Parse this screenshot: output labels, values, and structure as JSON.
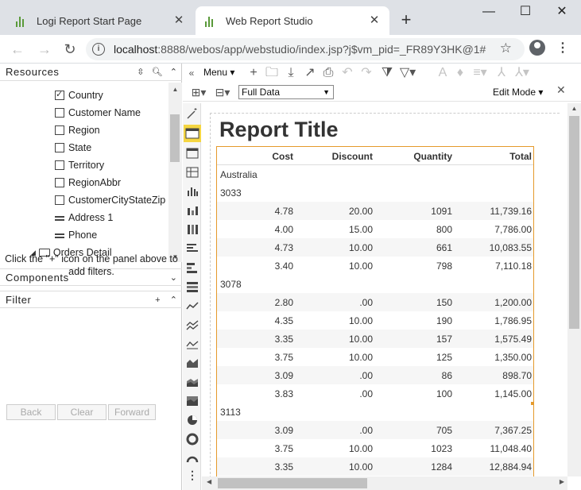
{
  "browser": {
    "tabs": [
      {
        "title": "Logi Report Start Page",
        "active": false
      },
      {
        "title": "Web Report Studio",
        "active": true
      }
    ],
    "url_host": "localhost",
    "url_path": ":8888/webos/app/webstudio/index.jsp?j$vm_pid=_FR89Y3HK@1#",
    "window_controls": {
      "minimize": "—",
      "maximize": "☐",
      "close": "✕"
    }
  },
  "left_panel": {
    "resources_title": "Resources",
    "tree": [
      {
        "label": "Country",
        "kind": "checkbox",
        "checked": true
      },
      {
        "label": "Customer Name",
        "kind": "checkbox",
        "checked": false
      },
      {
        "label": "Region",
        "kind": "checkbox",
        "checked": false
      },
      {
        "label": "State",
        "kind": "checkbox",
        "checked": false
      },
      {
        "label": "Territory",
        "kind": "checkbox",
        "checked": false
      },
      {
        "label": "RegionAbbr",
        "kind": "checkbox",
        "checked": false
      },
      {
        "label": "CustomerCityStateZip",
        "kind": "checkbox",
        "checked": false
      },
      {
        "label": "Address 1",
        "kind": "field"
      },
      {
        "label": "Phone",
        "kind": "field"
      },
      {
        "label": "Orders Detail",
        "kind": "folder"
      }
    ],
    "components_title": "Components",
    "filter_title": "Filter",
    "filter_help": "Click the \"+\" icon on the panel above to add filters.",
    "buttons": {
      "back": "Back",
      "clear": "Clear",
      "forward": "Forward"
    }
  },
  "studio": {
    "menu_label": "Menu",
    "data_view": "Full Data",
    "edit_mode": "Edit Mode",
    "report_title": "Report Title",
    "columns": [
      "Cost",
      "Discount",
      "Quantity",
      "Total"
    ],
    "groups": [
      {
        "type": "group",
        "label": "Australia"
      },
      {
        "type": "group",
        "label": "3033"
      },
      {
        "type": "row",
        "cells": [
          "4.78",
          "20.00",
          "1091",
          "11,739.16"
        ]
      },
      {
        "type": "row",
        "cells": [
          "4.00",
          "15.00",
          "800",
          "7,786.00"
        ]
      },
      {
        "type": "row",
        "cells": [
          "4.73",
          "10.00",
          "661",
          "10,083.55"
        ]
      },
      {
        "type": "row",
        "cells": [
          "3.40",
          "10.00",
          "798",
          "7,110.18"
        ]
      },
      {
        "type": "group",
        "label": "3078"
      },
      {
        "type": "row",
        "cells": [
          "2.80",
          ".00",
          "150",
          "1,200.00"
        ]
      },
      {
        "type": "row",
        "cells": [
          "4.35",
          "10.00",
          "190",
          "1,786.95"
        ]
      },
      {
        "type": "row",
        "cells": [
          "3.35",
          "10.00",
          "157",
          "1,575.49"
        ]
      },
      {
        "type": "row",
        "cells": [
          "3.75",
          "10.00",
          "125",
          "1,350.00"
        ]
      },
      {
        "type": "row",
        "cells": [
          "3.09",
          ".00",
          "86",
          "898.70"
        ]
      },
      {
        "type": "row",
        "cells": [
          "3.83",
          ".00",
          "100",
          "1,145.00"
        ]
      },
      {
        "type": "group",
        "label": "3113"
      },
      {
        "type": "row",
        "cells": [
          "3.09",
          ".00",
          "705",
          "7,367.25"
        ]
      },
      {
        "type": "row",
        "cells": [
          "3.75",
          "10.00",
          "1023",
          "11,048.40"
        ]
      },
      {
        "type": "row",
        "cells": [
          "3.35",
          "10.00",
          "1284",
          "12,884.94"
        ]
      }
    ]
  }
}
